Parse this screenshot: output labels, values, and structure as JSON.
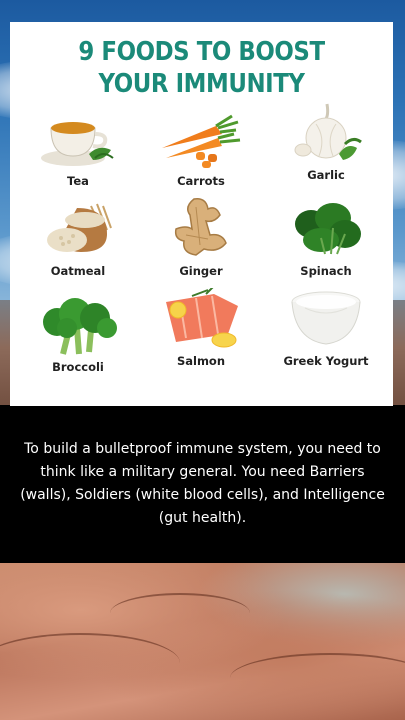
{
  "card": {
    "title_line1": "9 FOODS TO BOOST",
    "title_line2": "YOUR IMMUNITY",
    "title_color": "#1b8a79",
    "foods": [
      {
        "label": "Tea",
        "icon": "tea-cup-icon"
      },
      {
        "label": "Carrots",
        "icon": "carrots-icon"
      },
      {
        "label": "Garlic",
        "icon": "garlic-icon"
      },
      {
        "label": "Oatmeal",
        "icon": "oatmeal-icon"
      },
      {
        "label": "Ginger",
        "icon": "ginger-icon"
      },
      {
        "label": "Spinach",
        "icon": "spinach-icon"
      },
      {
        "label": "Broccoli",
        "icon": "broccoli-icon"
      },
      {
        "label": "Salmon",
        "icon": "salmon-icon"
      },
      {
        "label": "Greek Yogurt",
        "icon": "yogurt-bowl-icon"
      }
    ]
  },
  "caption": {
    "text": "To build a bulletproof immune system, you need to think like a military general. You need Barriers (walls), Soldiers (white blood cells), and Intelligence (gut health)."
  }
}
